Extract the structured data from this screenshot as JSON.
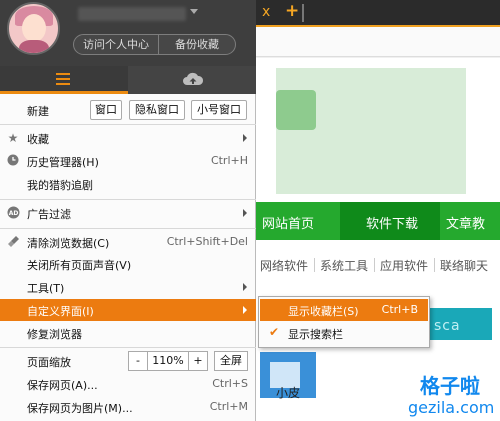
{
  "header": {
    "visit_center": "访问个人中心",
    "backup_favorites": "备份收藏"
  },
  "icons": {
    "menu_tab": "hamburger-icon",
    "cloud_tab": "cloud-upload-icon"
  },
  "menu": {
    "new_label": "新建",
    "new_buttons": [
      "窗口",
      "隐私窗口",
      "小号窗口"
    ],
    "items": [
      {
        "label": "收藏",
        "icon": "star-icon",
        "shortcut": "",
        "submenu": true
      },
      {
        "label": "历史管理器(H)",
        "icon": "clock-icon",
        "shortcut": "Ctrl+H",
        "submenu": false
      },
      {
        "label": "我的猎豹追剧",
        "icon": "",
        "shortcut": "",
        "submenu": false
      },
      {
        "label": "广告过滤",
        "icon": "adblock-icon",
        "shortcut": "",
        "submenu": true
      },
      {
        "label": "清除浏览数据(C)",
        "icon": "broom-icon",
        "shortcut": "Ctrl+Shift+Del",
        "submenu": false
      },
      {
        "label": "关闭所有页面声音(V)",
        "icon": "",
        "shortcut": "",
        "submenu": false
      },
      {
        "label": "工具(T)",
        "icon": "",
        "shortcut": "",
        "submenu": true
      },
      {
        "label": "自定义界面(I)",
        "icon": "",
        "shortcut": "",
        "submenu": true,
        "highlighted": true
      },
      {
        "label": "修复浏览器",
        "icon": "",
        "shortcut": "",
        "submenu": false
      },
      {
        "label": "保存网页(A)...",
        "icon": "",
        "shortcut": "Ctrl+S",
        "submenu": false
      },
      {
        "label": "保存网页为图片(M)...",
        "icon": "",
        "shortcut": "Ctrl+M",
        "submenu": false
      }
    ],
    "zoom": {
      "label": "页面缩放",
      "minus": "-",
      "value": "110%",
      "plus": "+",
      "fullscreen": "全屏"
    }
  },
  "submenu": {
    "items": [
      {
        "label": "显示收藏栏(S)",
        "shortcut": "Ctrl+B",
        "checked": false,
        "highlighted": true
      },
      {
        "label": "显示搜索栏",
        "shortcut": "",
        "checked": true,
        "highlighted": false
      }
    ]
  },
  "background": {
    "tab_close": "x",
    "tab_plus": "+",
    "nav": [
      "网站首页",
      "软件下载",
      "文章教"
    ],
    "subnav": [
      "网络软件",
      "系统工具",
      "应用软件",
      "联络聊天"
    ],
    "small_pc": "小皮",
    "teal_text": "sca",
    "watermark_cn": "格子啦",
    "watermark_url": "gezila.com"
  },
  "colors": {
    "accent": "#ec7b10",
    "header_bg": "#3e3e3e",
    "site_green": "#25a92e"
  }
}
